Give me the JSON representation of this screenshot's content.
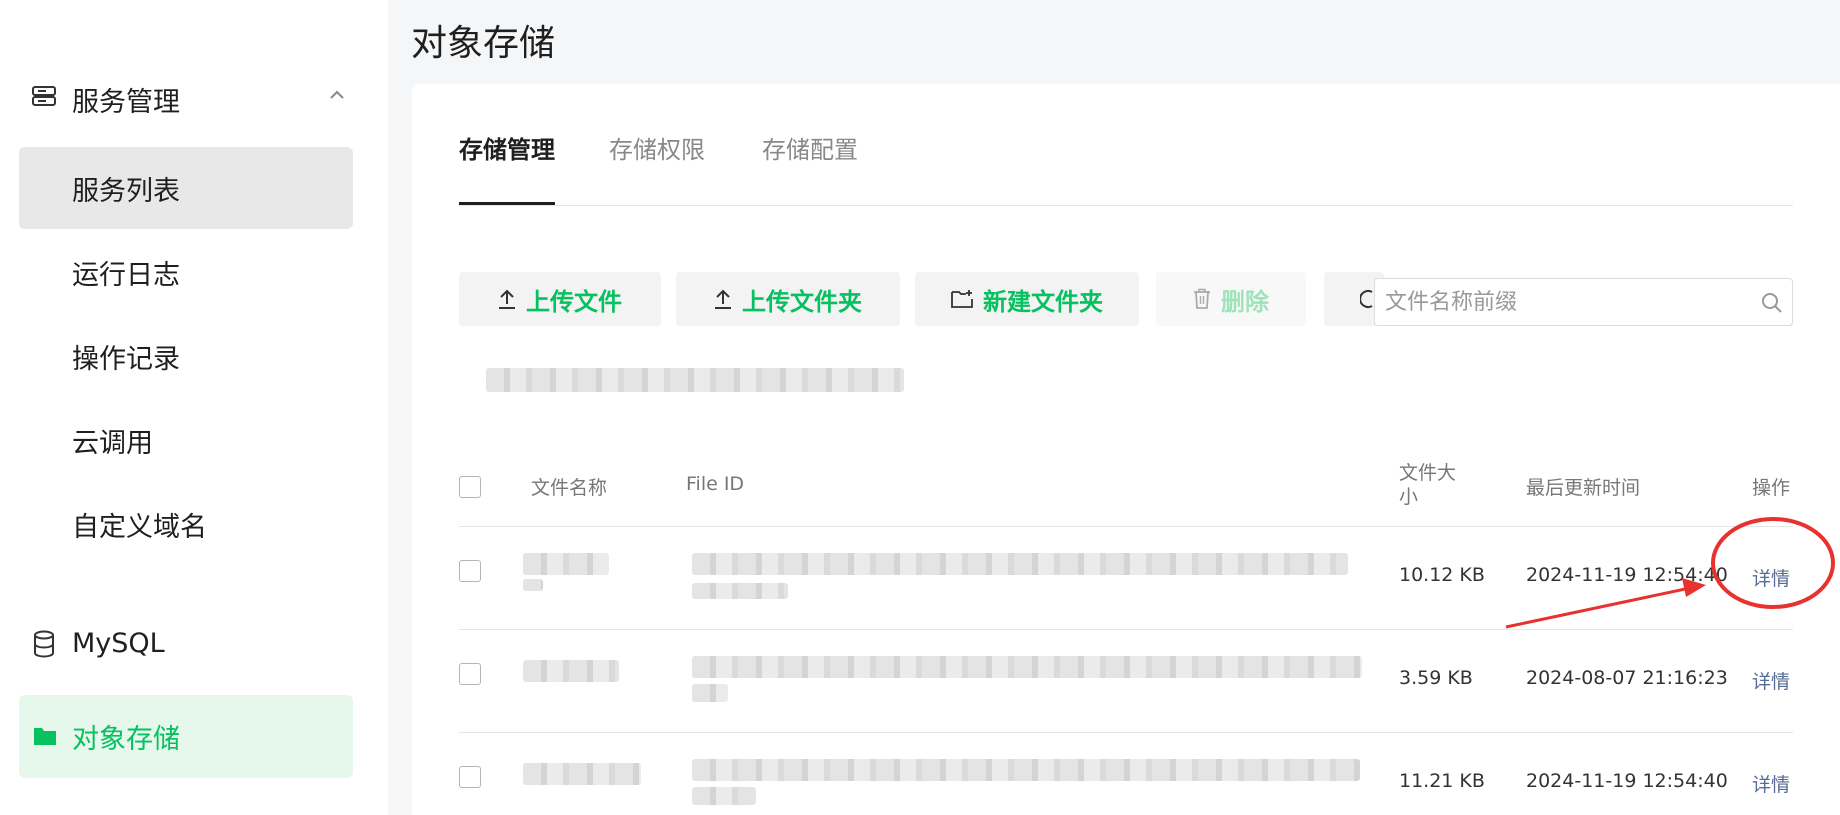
{
  "page": {
    "title": "对象存储"
  },
  "sidebar": {
    "group": {
      "label": "服务管理",
      "icon": "server-icon",
      "chevron": "chevron-up-icon"
    },
    "items": [
      {
        "label": "服务列表",
        "active": true
      },
      {
        "label": "运行日志"
      },
      {
        "label": "操作记录"
      },
      {
        "label": "云调用"
      },
      {
        "label": "自定义域名"
      }
    ],
    "mysql": {
      "label": "MySQL",
      "icon": "database-icon"
    },
    "object_storage": {
      "label": "对象存储",
      "icon": "folder-icon",
      "active": true
    }
  },
  "tabs": [
    {
      "label": "存储管理",
      "active": true
    },
    {
      "label": "存储权限"
    },
    {
      "label": "存储配置"
    }
  ],
  "toolbar": {
    "upload_file": "上传文件",
    "upload_folder": "上传文件夹",
    "new_folder": "新建文件夹",
    "delete": "删除"
  },
  "search": {
    "placeholder": "文件名称前缀"
  },
  "table": {
    "columns": {
      "name": "文件名称",
      "file_id": "File ID",
      "size": "文件大小",
      "updated": "最后更新时间",
      "actions": "操作"
    },
    "rows": [
      {
        "size": "10.12 KB",
        "updated": "2024-11-19 12:54:40",
        "action": "详情"
      },
      {
        "size": "3.59 KB",
        "updated": "2024-08-07 21:16:23",
        "action": "详情"
      },
      {
        "size": "11.21 KB",
        "updated": "2024-11-19 12:54:40",
        "action": "详情"
      }
    ]
  },
  "colors": {
    "accent": "#07c160",
    "link": "#576b95",
    "annotation": "#e8322f"
  }
}
